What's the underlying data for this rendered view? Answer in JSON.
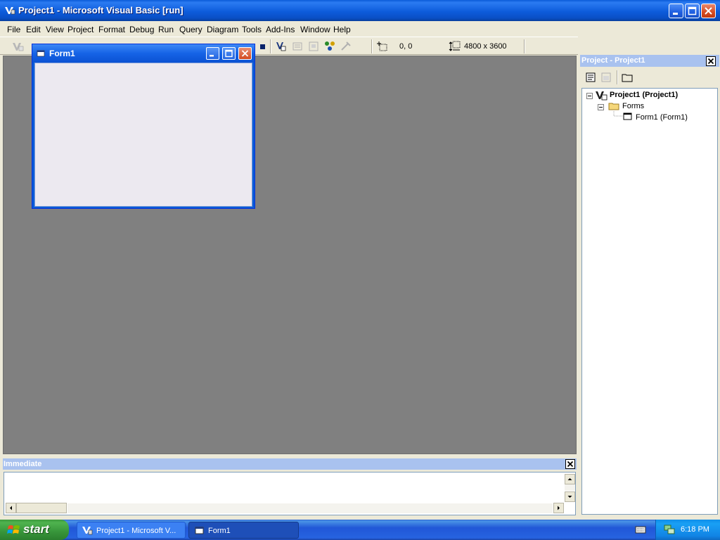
{
  "window": {
    "title": "Project1 - Microsoft Visual Basic [run]"
  },
  "menu": [
    "File",
    "Edit",
    "View",
    "Project",
    "Format",
    "Debug",
    "Run",
    "Query",
    "Diagram",
    "Tools",
    "Add-Ins",
    "Window",
    "Help"
  ],
  "toolbar": {
    "position": "0, 0",
    "size": "4800 x 3600"
  },
  "form1": {
    "title": "Form1"
  },
  "project_explorer": {
    "title": "Project - Project1",
    "tree": {
      "root": "Project1 (Project1)",
      "folder": "Forms",
      "item": "Form1 (Form1)"
    }
  },
  "immediate": {
    "title": "Immediate"
  },
  "taskbar": {
    "start": "start",
    "tasks": [
      "Project1 - Microsoft V...",
      "Form1"
    ],
    "clock": "6:18 PM"
  },
  "colors": {
    "title_blue": "#0A5BD8",
    "mdi_gray": "#808080",
    "taskbar_blue": "#2157D7",
    "start_green": "#37953A"
  }
}
